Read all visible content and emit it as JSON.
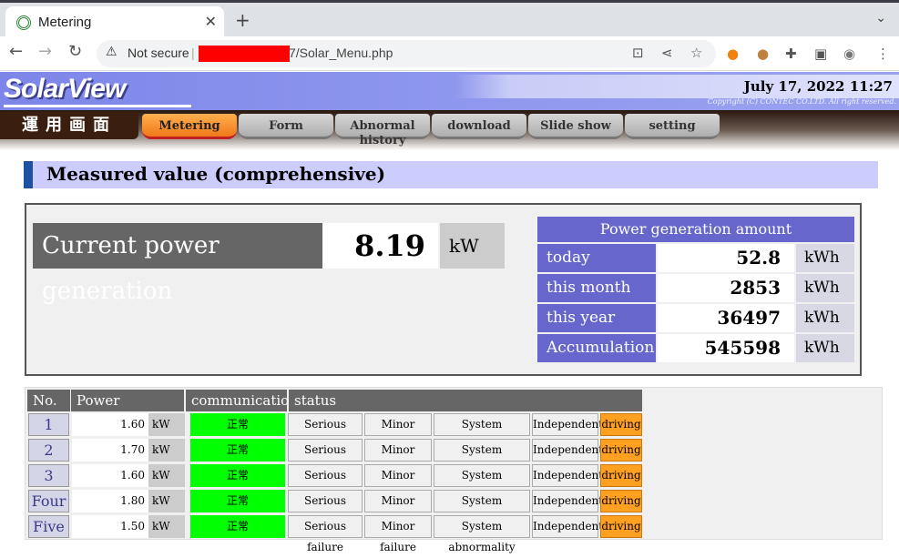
{
  "browser": {
    "tab_title": "Metering",
    "not_secure": "Not secure",
    "url_suffix": "7/Solar_Menu.php"
  },
  "header": {
    "logo": "SolarView",
    "date": "July 17, 2022 11:27",
    "copyright": "Copyright (C) CONTEC CO.LTD. All right reserved."
  },
  "menu": {
    "title": "運用画面",
    "items": [
      "Metering",
      "Form",
      "Abnormal history",
      "download",
      "Slide show",
      "setting"
    ],
    "active": "Metering"
  },
  "section_title": "Measured value (comprehensive)",
  "current": {
    "label": "Current power generation",
    "value": "8.19",
    "unit": "kW"
  },
  "generation": {
    "heading": "Power generation amount",
    "rows": [
      {
        "label": "today",
        "value": "52.8",
        "unit": "kWh"
      },
      {
        "label": "this month",
        "value": "2853",
        "unit": "kWh"
      },
      {
        "label": "this year",
        "value": "36497",
        "unit": "kWh"
      },
      {
        "label": "Accumulation",
        "value": "545598",
        "unit": "kWh"
      }
    ]
  },
  "table": {
    "headers": {
      "no": "No.",
      "power": "Power generation",
      "comm": "communication",
      "status": "status"
    },
    "status_labels": [
      "Serious failure",
      "Minor failure",
      "System abnormality",
      "Independent",
      "driving"
    ],
    "rows": [
      {
        "no": "1",
        "value": "1.60",
        "unit": "kW",
        "comm": "正常"
      },
      {
        "no": "2",
        "value": "1.70",
        "unit": "kW",
        "comm": "正常"
      },
      {
        "no": "3",
        "value": "1.60",
        "unit": "kW",
        "comm": "正常"
      },
      {
        "no": "Four",
        "value": "1.80",
        "unit": "kW",
        "comm": "正常"
      },
      {
        "no": "Five",
        "value": "1.50",
        "unit": "kW",
        "comm": "正常"
      }
    ]
  },
  "colors": {
    "accent": "#6666cc",
    "menu_active": "#f07818",
    "status_ok": "#00ff00",
    "driving": "#ffa020"
  }
}
